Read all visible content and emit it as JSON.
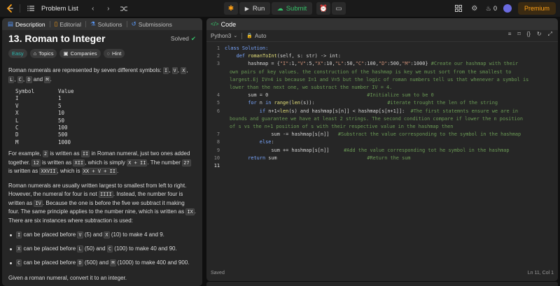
{
  "topbar": {
    "problem_list_label": "Problem List",
    "run_label": "Run",
    "submit_label": "Submit",
    "fire_count": "0",
    "premium_label": "Premium",
    "submit_color": "#36c26a",
    "premium_color": "#ffa116"
  },
  "left_tabs": [
    "Description",
    "Editorial",
    "Solutions",
    "Submissions"
  ],
  "problem": {
    "title": "13. Roman to Integer",
    "status": "Solved",
    "difficulty": "Easy",
    "chips": [
      "Topics",
      "Companies",
      "Hint"
    ],
    "intro_a": "Roman numerals are represented by seven different symbols: ",
    "intro_sep": ", ",
    "intro_and": " and ",
    "intro_end": ".",
    "symbols_list": [
      "I",
      "V",
      "X",
      "L",
      "C",
      "D",
      "M"
    ],
    "table_header": [
      "Symbol",
      "Value"
    ],
    "table_rows": [
      [
        "I",
        "1"
      ],
      [
        "V",
        "5"
      ],
      [
        "X",
        "10"
      ],
      [
        "L",
        "50"
      ],
      [
        "C",
        "100"
      ],
      [
        "D",
        "500"
      ],
      [
        "M",
        "1000"
      ]
    ],
    "p2": {
      "t1": "For example, ",
      "c1": "2",
      "t2": " is written as ",
      "c2": "II",
      "t3": " in Roman numeral, just two ones added together. ",
      "c3": "12",
      "t4": " is written as ",
      "c4": "XII",
      "t5": ", which is simply ",
      "c5": "X + II",
      "t6": ". The number ",
      "c6": "27",
      "t7": " is written as ",
      "c7": "XXVII",
      "t8": ", which is ",
      "c8": "XX + V + II",
      "t9": "."
    },
    "p3": {
      "t1": "Roman numerals are usually written largest to smallest from left to right. However, the numeral for four is not ",
      "c1": "IIII",
      "t2": ". Instead, the number four is written as ",
      "c2": "IV",
      "t3": ". Because the one is before the five we subtract it making four. The same principle applies to the number nine, which is written as ",
      "c3": "IX",
      "t4": ". There are six instances where subtraction is used:"
    },
    "bullets": [
      {
        "c1": "I",
        "t1": " can be placed before ",
        "c2": "V",
        "t2": " (5) and ",
        "c3": "X",
        "t3": " (10) to make 4 and 9."
      },
      {
        "c1": "X",
        "t1": " can be placed before ",
        "c2": "L",
        "t2": " (50) and ",
        "c3": "C",
        "t3": " (100) to make 40 and 90."
      },
      {
        "c1": "C",
        "t1": " can be placed before ",
        "c2": "D",
        "t2": " (500) and ",
        "c3": "M",
        "t3": " (1000) to make 400 and 900."
      }
    ],
    "final": "Given a roman numeral, convert it to an integer."
  },
  "editor": {
    "header_title": "Code",
    "language": "Python3",
    "mode": "Auto",
    "status_left": "Saved",
    "status_right": "Ln 11, Col 1",
    "line_numbers": [
      "1",
      "2",
      "3",
      "4",
      "5",
      "6",
      "7",
      "8",
      "9",
      "10",
      "11"
    ],
    "code": {
      "l1": "class Solution:",
      "l2a": "    def ",
      "l2b": "romanToInt",
      "l2c": "(self, s: str) -> int:",
      "l3a": "        hashmap = {",
      "l3b": "\"I\"",
      "l3c": ":1,",
      "l3d": "\"V\"",
      "l3e": ":5,",
      "l3f": "\"X\"",
      "l3g": ":10,",
      "l3h": "\"L\"",
      "l3i": ":50,",
      "l3j": "\"C\"",
      "l3k": ":100,",
      "l3l": "\"D\"",
      "l3m": ":500,",
      "l3n": "\"M\"",
      "l3o": ":1000} ",
      "l3comment_a": "#Create our hashmap with their",
      "l3comment_b": "own pairs of key values. the construction of the hashmap is key we must sort from the smallest to",
      "l3comment_c": "largest.Ej IV=4 is because I=1 and V=5 but the logic of roman numbers tell us that whenever a symbol is",
      "l3comment_d": "lower than the next one, we substract the number IV = 4.",
      "l4a": "        sum = 0                                  ",
      "l4b": "#Initialize sum to be 0",
      "l5a": "        ",
      "l5b": "for",
      "l5c": " n ",
      "l5d": "in",
      "l5e": " ",
      "l5f": "range",
      "l5g": "(",
      "l5h": "len",
      "l5i": "(s)):                         ",
      "l5j": "#iterate trought the len of the string",
      "l6a": "            ",
      "l6b": "if",
      "l6c": " n+1<",
      "l6d": "len",
      "l6e": "(s) and hashmap[s[n]] < hashmap[s[n+1]]:  ",
      "l6comment_a": "#The first statemnts ensure we are in",
      "l6comment_b": "bounds and guarantee we have at least 2 strings. The second condition compare if lower the n position",
      "l6comment_c": "of s vs the n+1 position of s with their respective value in the hashmap then",
      "l7a": "                sum -= hashmap[s[n]]   ",
      "l7b": "#Substract the value corresponding to the symbol in the hashmap",
      "l8a": "            ",
      "l8b": "else",
      "l8c": ":",
      "l9a": "                sum += hashmap[s[n]]     ",
      "l9b": "#Add the value corresponding tot he symbol in the hashmap",
      "l10a": "        ",
      "l10b": "return",
      "l10c": " sum                               ",
      "l10d": "#Return the sum",
      "l11": ""
    }
  }
}
